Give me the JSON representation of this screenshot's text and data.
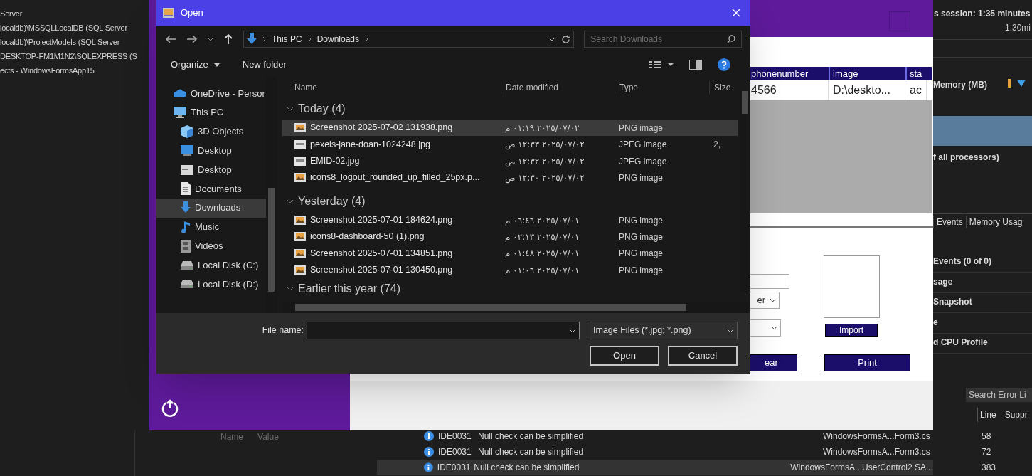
{
  "ide_left": {
    "explorer_items": [
      "Server",
      "localdb)\\MSSQLLocalDB (SQL Server",
      "localdb)\\ProjectModels (SQL Server",
      "DESKTOP-FM1M1N2\\SQLEXPRESS (S",
      "ects - WindowsFormsApp15"
    ],
    "properties_columns": [
      "Name",
      "Value"
    ]
  },
  "ide_right": {
    "session": "s session: 1:35 minutes",
    "time_tick": "1:30mi",
    "memory_label": "Memory (MB)",
    "cpu_label": "f all processors)",
    "tabs": [
      "Events",
      "Memory Usag"
    ],
    "summary_items": [
      "Events (0 of 0)",
      "sage",
      "Snapshot",
      "e",
      "d CPU Profile"
    ],
    "error_search": {
      "placeholder": "Search Error Li"
    },
    "error_columns": [
      "Line",
      "Suppr"
    ]
  },
  "error_list": [
    {
      "code": "IDE0031",
      "message": "Null check can be simplified",
      "file": "WindowsFormsA...Form3.cs",
      "line": "58",
      "selected": false
    },
    {
      "code": "IDE0031",
      "message": "Null check can be simplified",
      "file": "WindowsFormsA...Form3.cs",
      "line": "72",
      "selected": false
    },
    {
      "code": "IDE0031",
      "message": "Null check can be simplified",
      "file": "WindowsFormsA...UserControl2 SA...",
      "line": "383",
      "selected": true
    }
  ],
  "form_window": {
    "grid": {
      "columns": [
        "phonenumber",
        "image",
        "sta"
      ],
      "rows": [
        [
          "4566",
          "D:\\deskto...",
          "ac"
        ]
      ]
    },
    "combo_value": "er",
    "buttons": [
      {
        "label": "Import",
        "kind": "small"
      },
      {
        "label": "ear",
        "kind": "wide"
      },
      {
        "label": "Print",
        "kind": "wide"
      }
    ]
  },
  "dialog": {
    "title": "Open",
    "path": [
      "This PC",
      "Downloads"
    ],
    "search": {
      "placeholder": "Search Downloads"
    },
    "toolbar": [
      {
        "label": "Organize",
        "dropdown": true
      },
      {
        "label": "New folder",
        "dropdown": false
      }
    ],
    "nav": [
      {
        "label": "OneDrive - Persor",
        "kind": "cloud",
        "selected": false
      },
      {
        "label": "This PC",
        "kind": "pc",
        "selected": false,
        "children": [
          {
            "label": "3D Objects",
            "kind": "cube",
            "selected": false
          },
          {
            "label": "Desktop",
            "kind": "desktop",
            "selected": false
          },
          {
            "label": "Desktop",
            "kind": "folder",
            "selected": false
          },
          {
            "label": "Documents",
            "kind": "document",
            "selected": false
          },
          {
            "label": "Downloads",
            "kind": "download",
            "selected": true
          },
          {
            "label": "Music",
            "kind": "music",
            "selected": false
          },
          {
            "label": "Videos",
            "kind": "video",
            "selected": false
          },
          {
            "label": "Local Disk (C:)",
            "kind": "disk",
            "selected": false
          },
          {
            "label": "Local Disk (D:)",
            "kind": "disk",
            "selected": false
          }
        ]
      }
    ],
    "columns": [
      "Name",
      "Date modified",
      "Type",
      "Size"
    ],
    "groups": [
      {
        "label": "Today (4)",
        "files": [
          {
            "name": "Screenshot 2025-07-02 131938.png",
            "kind": "image",
            "date": "٢٠٢٥/٠٧/٠٢ ٠١:١٩ م",
            "type": "PNG image",
            "selected": true
          },
          {
            "name": "pexels-jane-doan-1024248.jpg",
            "kind": "photo",
            "date": "٢٠٢٥/٠٧/٠٢ ١٢:٣٣ ص",
            "type": "JPEG image",
            "size": "2,",
            "selected": false
          },
          {
            "name": "EMID-02.jpg",
            "kind": "photo",
            "date": "٢٠٢٥/٠٧/٠٢ ١٢:٣٢ ص",
            "type": "JPEG image",
            "selected": false
          },
          {
            "name": "icons8_logout_rounded_up_filled_25px.p...",
            "kind": "image",
            "date": "٢٠٢٥/٠٧/٠٢ ١٢:٣٠ ص",
            "type": "PNG image",
            "selected": false
          }
        ]
      },
      {
        "label": "Yesterday (4)",
        "files": [
          {
            "name": "Screenshot 2025-07-01 184624.png",
            "kind": "image",
            "date": "٢٠٢٥/٠٧/٠١ ٠٦:٤٦ م",
            "type": "PNG image",
            "selected": false
          },
          {
            "name": "icons8-dashboard-50 (1).png",
            "kind": "image",
            "date": "٢٠٢٥/٠٧/٠١ ٠٢:١٣ م",
            "type": "PNG image",
            "selected": false
          },
          {
            "name": "Screenshot 2025-07-01 134851.png",
            "kind": "image",
            "date": "٢٠٢٥/٠٧/٠١ ٠١:٤٨ م",
            "type": "PNG image",
            "selected": false
          },
          {
            "name": "Screenshot 2025-07-01 130450.png",
            "kind": "image",
            "date": "٢٠٢٥/٠٧/٠١ ٠١:٠٦ م",
            "type": "PNG image",
            "selected": false
          }
        ]
      },
      {
        "label": "Earlier this year (74)"
      }
    ],
    "file_name_label": "File name:",
    "filter": "Image Files (*.jpg; *.png)",
    "buttons": [
      "Open",
      "Cancel"
    ]
  }
}
